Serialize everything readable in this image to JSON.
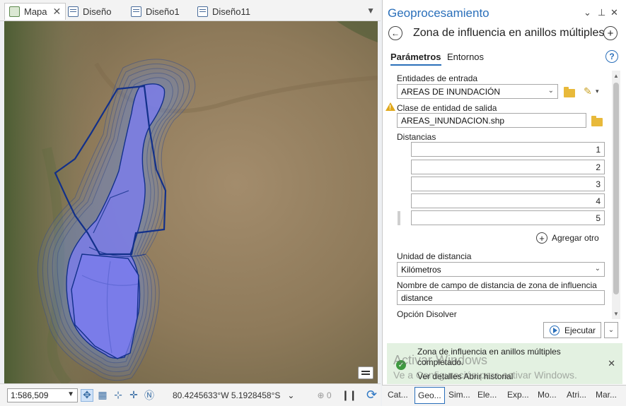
{
  "map_tabs": [
    {
      "label": "Mapa",
      "icon": "map-icon",
      "active": true
    },
    {
      "label": "Diseño",
      "icon": "layout-icon"
    },
    {
      "label": "Diseño1",
      "icon": "layout-icon"
    },
    {
      "label": "Diseño11",
      "icon": "layout-icon"
    }
  ],
  "status_bar": {
    "scale": "1:586,509",
    "coordinates": "80.4245633°W 5.1928458°S",
    "selected_count": "0"
  },
  "gp": {
    "title": "Geoprocesamiento",
    "tool_name": "Zona de influencia en anillos múltiples",
    "tabs": {
      "params": "Parámetros",
      "envs": "Entornos"
    },
    "input_label": "Entidades de entrada",
    "input_value": "AREAS DE INUNDACIÓN",
    "output_label": "Clase de entidad de salida",
    "output_value": "AREAS_INUNDACION.shp",
    "distances_label": "Distancias",
    "distances": [
      "1",
      "2",
      "3",
      "4",
      "5"
    ],
    "add_other": "Agregar otro",
    "unit_label": "Unidad de distancia",
    "unit_value": "Kilómetros",
    "field_label": "Nombre de campo de distancia de zona de influencia",
    "field_value": "distance",
    "dissolve_label": "Opción Disolver",
    "run_label": "Ejecutar",
    "status_message": "Zona de influencia en anillos múltiples completado.",
    "status_links": "Ver detalles  Abrir historial",
    "watermark_title": "Activar Windows",
    "watermark_sub": "Ve a Configuración para activar Windows."
  },
  "bottom_tabs": [
    "Cat...",
    "Geo...",
    "Sim...",
    "Ele...",
    "Exp...",
    "Mo...",
    "Atri...",
    "Mar..."
  ],
  "colors": {
    "accent": "#2a6fba",
    "buffer_fill": "#6f8fd6",
    "flood_fill": "#7b7cf0",
    "outline": "#12308a",
    "success": "#3e9a40"
  }
}
